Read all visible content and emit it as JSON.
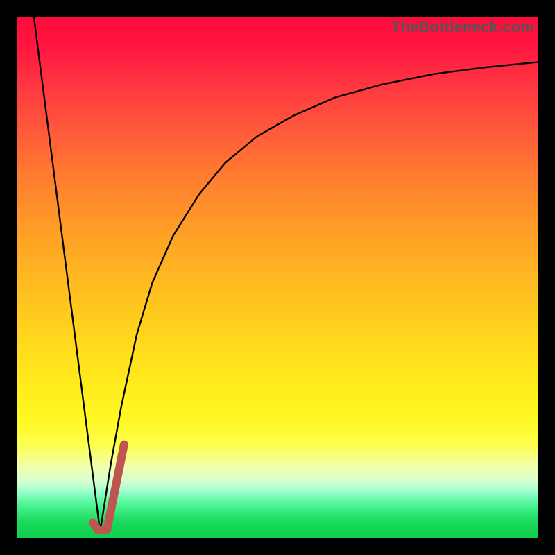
{
  "watermark": "TheBottleneck.com",
  "colors": {
    "background_frame": "#000000",
    "curve_line": "#000000",
    "marker": "#c0554f",
    "gradient_top": "#ff0a3a",
    "gradient_bottom": "#0ecf4c"
  },
  "chart_data": {
    "type": "line",
    "title": "",
    "xlabel": "",
    "ylabel": "",
    "xlim": [
      0,
      100
    ],
    "ylim": [
      0,
      100
    ],
    "note": "Percent-of-plot-area coordinates; y=0 at bottom, y=100 at top. Values estimated from pixels.",
    "series": [
      {
        "name": "left-descending-line",
        "x": [
          3.3,
          16.0
        ],
        "y": [
          100,
          1.3
        ]
      },
      {
        "name": "right-ascending-curve",
        "x": [
          16.0,
          18,
          20,
          23,
          26,
          30,
          35,
          40,
          46,
          53,
          61,
          70,
          80,
          90,
          100
        ],
        "y": [
          1.3,
          14,
          25,
          39,
          49,
          58,
          66,
          72,
          77,
          81,
          84.5,
          87,
          89,
          90.3,
          91.3
        ]
      }
    ],
    "marker": {
      "name": "J-shaped-marker",
      "points_xy": [
        [
          14.6,
          3.0
        ],
        [
          15.6,
          1.6
        ],
        [
          17.3,
          1.6
        ],
        [
          20.6,
          18.0
        ]
      ]
    }
  }
}
